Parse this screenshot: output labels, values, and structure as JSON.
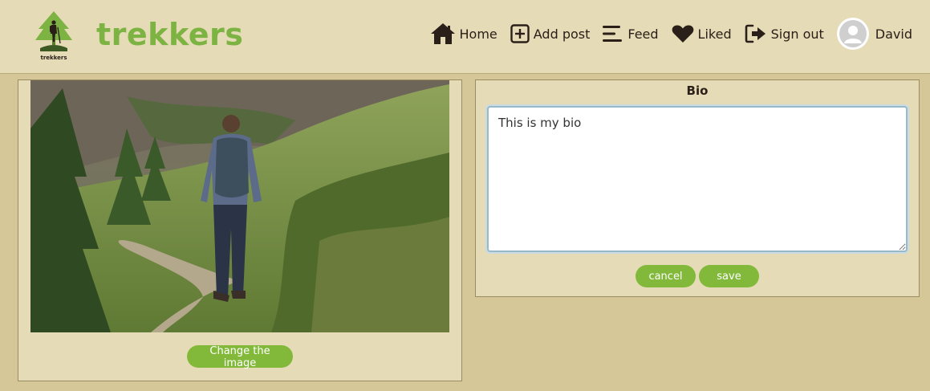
{
  "brand": {
    "logo_caption": "trekkers",
    "name": "trekkers",
    "color": "#7cb342"
  },
  "nav": {
    "items": [
      {
        "icon": "home-icon",
        "label": "Home"
      },
      {
        "icon": "add-post-icon",
        "label": "Add post"
      },
      {
        "icon": "feed-icon",
        "label": "Feed"
      },
      {
        "icon": "heart-icon",
        "label": "Liked"
      },
      {
        "icon": "sign-out-icon",
        "label": "Sign out"
      }
    ],
    "user": {
      "icon": "avatar-icon",
      "name": "David"
    }
  },
  "image_panel": {
    "image": "hiker-on-mountain-trail",
    "change_button": "Change the image"
  },
  "bio_panel": {
    "title": "Bio",
    "value": "This is my bio",
    "cancel_button": "cancel",
    "save_button": "save"
  },
  "colors": {
    "page_background": "#d6c798",
    "panel_background": "#e5dbb6",
    "button_green": "#82b93a",
    "text_dark": "#2a2019"
  }
}
